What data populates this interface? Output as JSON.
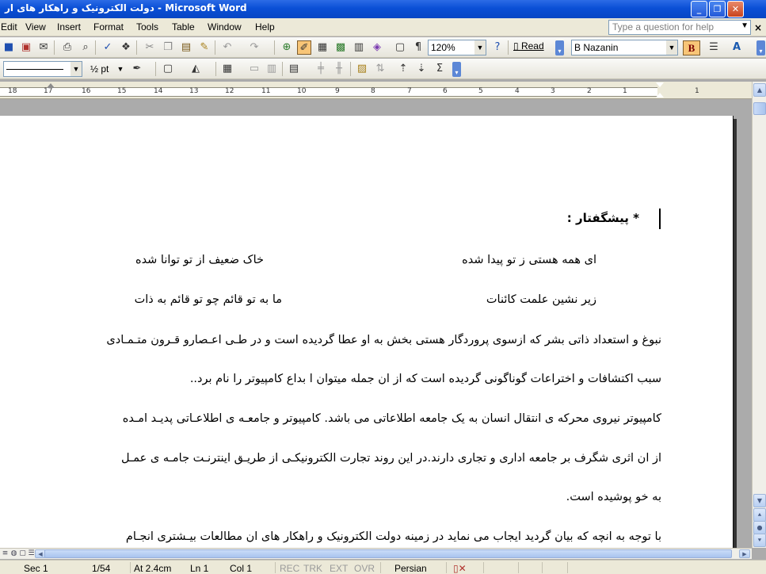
{
  "titlebar": {
    "title": "دولت الکترونیک و راهکار های ار - Microsoft Word",
    "min_glyph": "_",
    "max_glyph": "❐",
    "close_glyph": "✕"
  },
  "menu": {
    "items": [
      "Edit",
      "View",
      "Insert",
      "Format",
      "Tools",
      "Table",
      "Window",
      "Help"
    ],
    "help_placeholder": "Type a question for help",
    "doc_close": "×"
  },
  "toolbar": {
    "zoom": "120%",
    "read_label": "Read",
    "font_name": "B Nazanin",
    "bold_label": "B",
    "line_weight": "½ pt"
  },
  "ruler": {
    "numbers": [
      "18",
      "17",
      "16",
      "15",
      "14",
      "13",
      "12",
      "11",
      "10",
      "9",
      "8",
      "7",
      "6",
      "5",
      "4",
      "3",
      "2",
      "1",
      "1"
    ]
  },
  "document": {
    "heading": "* پیشگفتار :",
    "poem": [
      {
        "right": "ای همه هستی ز تو پیدا شده",
        "left": "خاک ضعیف از تو توانا شده"
      },
      {
        "right": "زیر  نشین علمت کائنات",
        "left": "ما به تو قائم چو تو قائم به ذات"
      }
    ],
    "paragraph_lines": [
      "نبوغ و استعداد ذاتی بشر که ازسوی پروردگار هستی بخش به او عطا گردیده است و در طـی اعـصارو قـرون متـمـادی",
      "سبب اکتشافات و اختراعات گوناگونی گردیده است که از ان جمله میتوان ا بداع کامپیوتر را نام برد..",
      "کامپیوتر نیروی محرکه ی انتقال انسان به یک جامعه اطلاعاتی می باشد. کامپیوتر و جامعـه ی اطلاعـاتی پدیـد امـده",
      "از ان اثری شگرف  بر جامعه اداری و تجاری دارند.در این روند تجارت الکترونیکـی از طریـق اینترنـت  جامـه ی عمـل",
      "به خو پوشیده است.",
      "با توجه به انچه که بیان گردید ایجاب می نماید در زمینه دولت الکترونیک و راهکار های ان مطالعات بیـشتری انجـام"
    ]
  },
  "status": {
    "sec": "Sec 1",
    "page": "1/54",
    "at": "At 2.4cm",
    "ln": "Ln 1",
    "col": "Col 1",
    "rec": "REC",
    "trk": "TRK",
    "ext": "EXT",
    "ovr": "OVR",
    "language": "Persian"
  }
}
